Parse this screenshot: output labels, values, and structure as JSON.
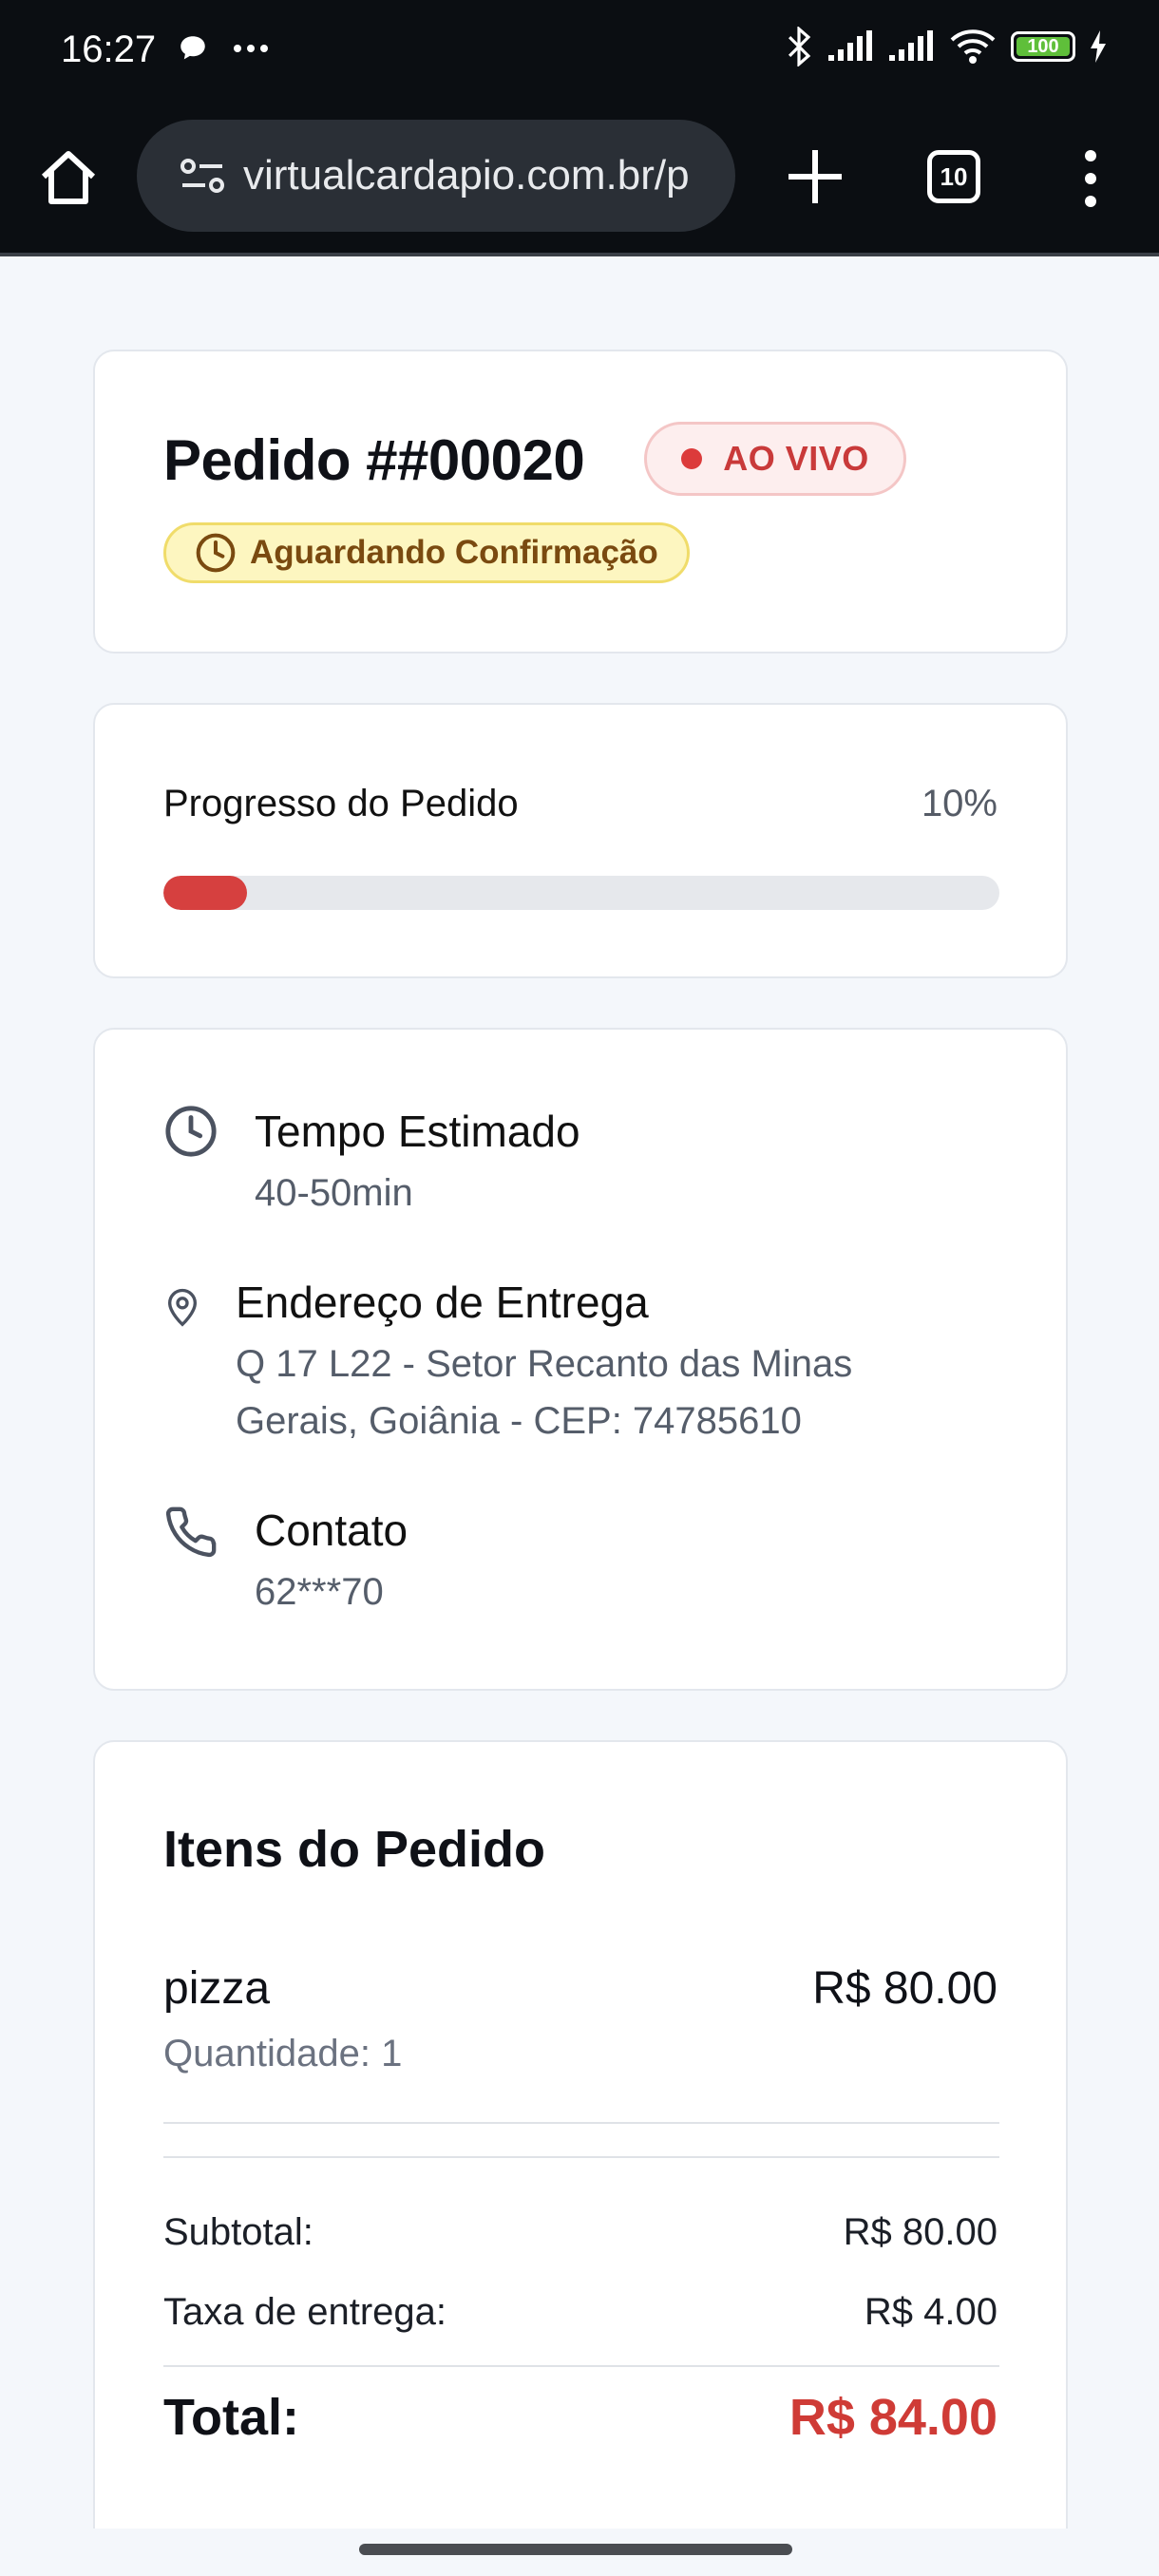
{
  "status_bar": {
    "time": "16:27",
    "battery": "100"
  },
  "browser": {
    "url": "virtualcardapio.com.br/p",
    "tab_count": "10"
  },
  "order": {
    "title": "Pedido ##00020",
    "live_label": "AO VIVO",
    "status": "Aguardando Confirmação"
  },
  "progress": {
    "label": "Progresso do Pedido",
    "value_text": "10%",
    "value": 10
  },
  "details": {
    "time_title": "Tempo Estimado",
    "time_value": "40-50min",
    "address_title": "Endereço de Entrega",
    "address_line1": "Q 17 L22 - Setor Recanto das Minas",
    "address_line2": "Gerais, Goiânia - CEP: 74785610",
    "contact_title": "Contato",
    "contact_value": "62***70"
  },
  "items": {
    "title": "Itens do Pedido",
    "list": [
      {
        "name": "pizza",
        "quantity": "Quantidade: 1",
        "price": "R$ 80.00"
      }
    ],
    "subtotal_label": "Subtotal:",
    "subtotal_value": "R$ 80.00",
    "fee_label": "Taxa de entrega:",
    "fee_value": "R$ 4.00",
    "total_label": "Total:",
    "total_value": "R$ 84.00"
  },
  "colors": {
    "accent_red": "#d6403f",
    "status_yellow": "#fdf6c0"
  }
}
